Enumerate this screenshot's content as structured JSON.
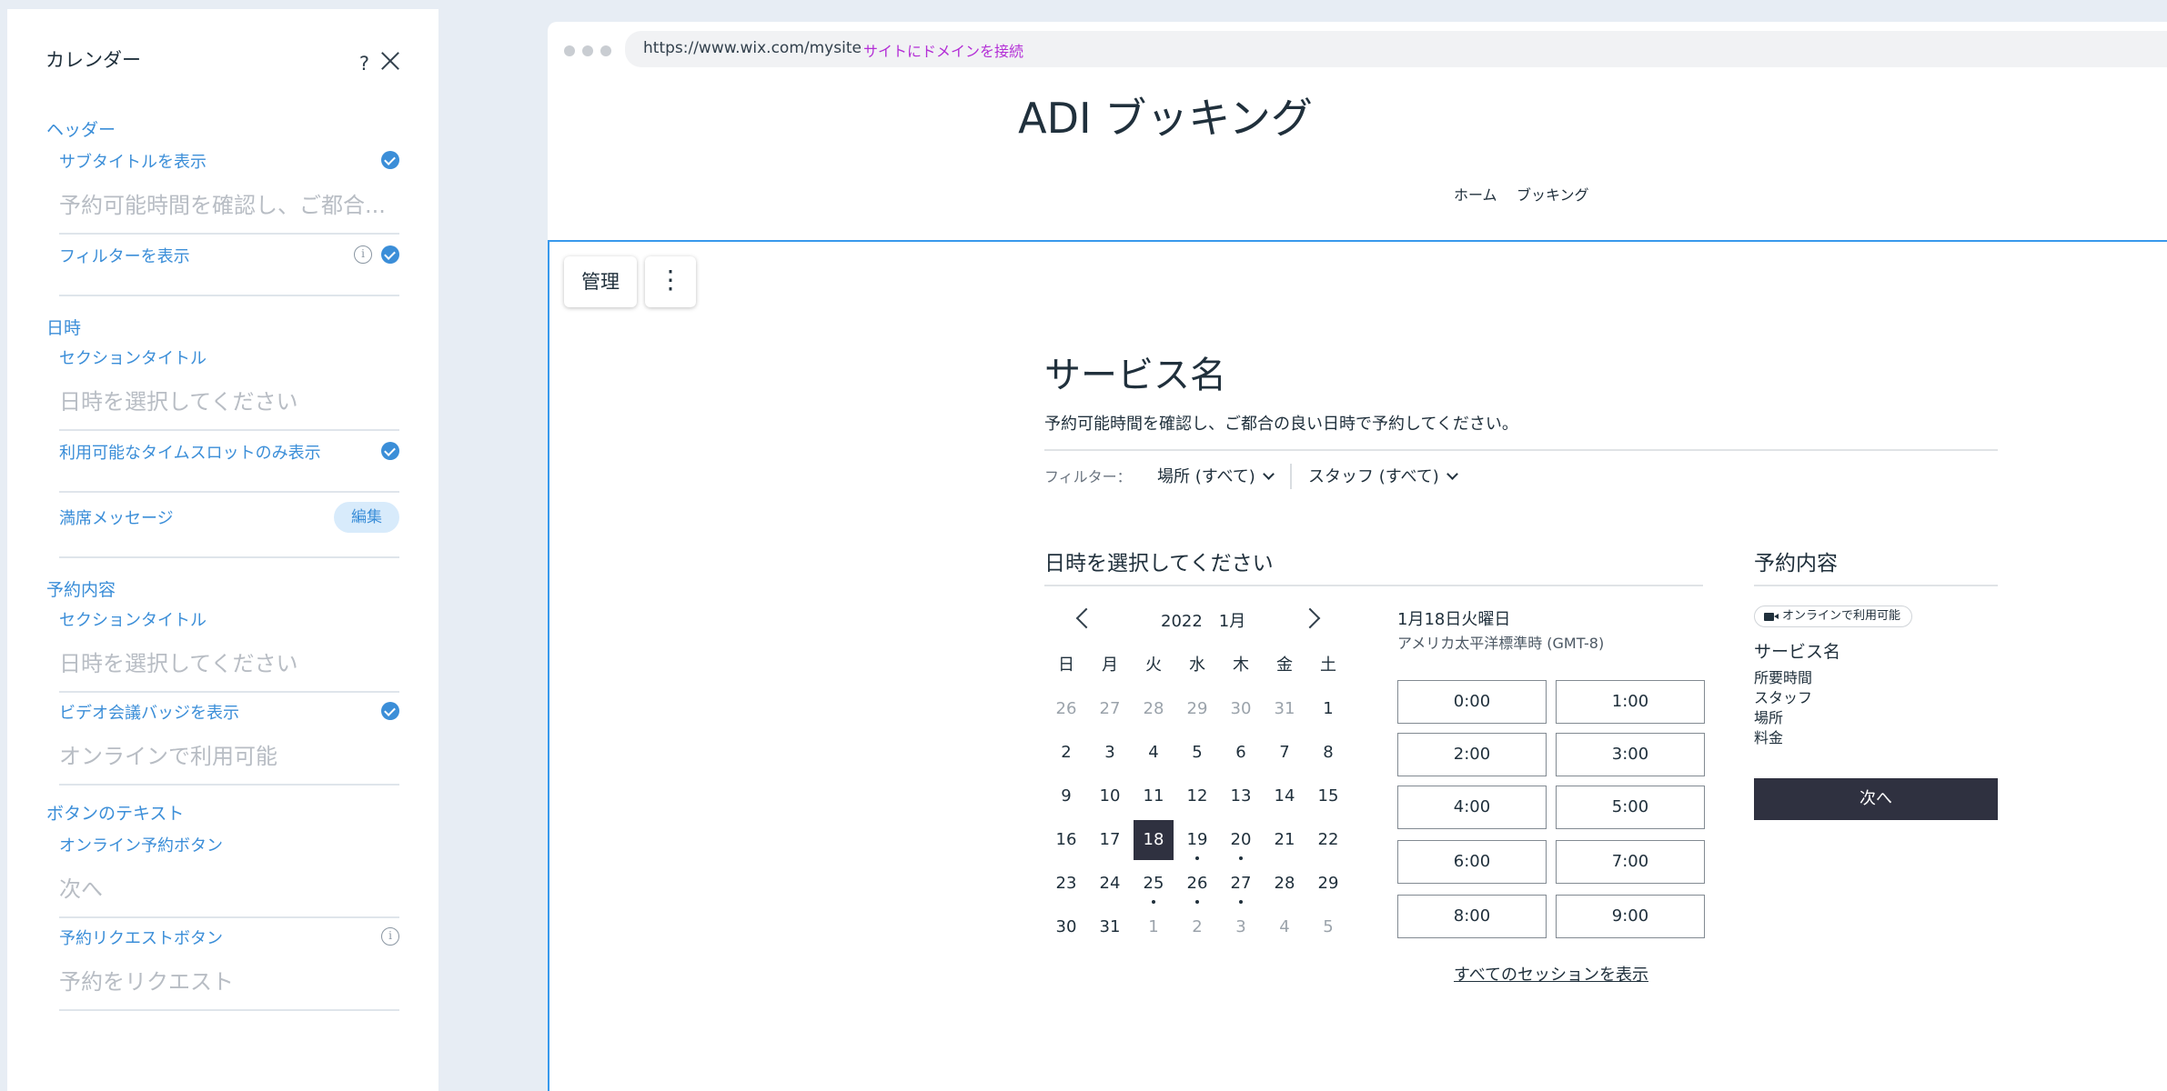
{
  "panel": {
    "title": "カレンダー",
    "help": "?",
    "sections": {
      "header": "ヘッダー",
      "datetime": "日時",
      "booking_details": "予約内容",
      "button_text": "ボタンのテキスト"
    },
    "rows": {
      "show_subtitle": {
        "label": "サブタイトルを表示",
        "value": "予約可能時間を確認し、ご都合...",
        "checked": true
      },
      "show_filter": {
        "label": "フィルターを表示",
        "checked": true
      },
      "dt_section_title": {
        "label": "セクションタイトル",
        "value": "日時を選択してください"
      },
      "only_available": {
        "label": "利用可能なタイムスロットのみ表示",
        "checked": true
      },
      "full_message": {
        "label": "満席メッセージ",
        "button": "編集"
      },
      "bd_section_title": {
        "label": "セクションタイトル",
        "value": "日時を選択してください"
      },
      "video_badge": {
        "label": "ビデオ会議バッジを表示",
        "value": "オンラインで利用可能",
        "checked": true
      },
      "online_button": {
        "label": "オンライン予約ボタン",
        "value": "次へ"
      },
      "request_button": {
        "label": "予約リクエストボタン",
        "value": "予約をリクエスト"
      }
    }
  },
  "browser": {
    "url": "https://www.wix.com/mysite",
    "connect_domain": "サイトにドメインを接続"
  },
  "site": {
    "title": "ADI ブッキング",
    "nav": [
      "ホーム",
      "ブッキング"
    ]
  },
  "editor": {
    "manage": "管理",
    "more": "⋮"
  },
  "widget": {
    "service_title": "サービス名",
    "description": "予約可能時間を確認し、ご都合の良い日時で予約してください。",
    "filter_label": "フィルター：",
    "filter_location": "場所 (すべて)",
    "filter_staff": "スタッフ (すべて)",
    "datetime_heading": "日時を選択してください",
    "calendar": {
      "month_label": "2022　1月",
      "weekdays": [
        "日",
        "月",
        "火",
        "水",
        "木",
        "金",
        "土"
      ],
      "weeks": [
        [
          "26",
          "27",
          "28",
          "29",
          "30",
          "31",
          "1"
        ],
        [
          "2",
          "3",
          "4",
          "5",
          "6",
          "7",
          "8"
        ],
        [
          "9",
          "10",
          "11",
          "12",
          "13",
          "14",
          "15"
        ],
        [
          "16",
          "17",
          "18",
          "19",
          "20",
          "21",
          "22"
        ],
        [
          "23",
          "24",
          "25",
          "26",
          "27",
          "28",
          "29"
        ],
        [
          "30",
          "31",
          "1",
          "2",
          "3",
          "4",
          "5"
        ]
      ],
      "selected_day": "18",
      "days_with_availability": [
        "19",
        "20",
        "25",
        "26",
        "27"
      ]
    },
    "selected_date": "1月18日火曜日",
    "timezone": "アメリカ太平洋標準時 (GMT-8)",
    "slots": [
      "0:00",
      "1:00",
      "2:00",
      "3:00",
      "4:00",
      "5:00",
      "6:00",
      "7:00",
      "8:00",
      "9:00"
    ],
    "show_all_sessions": "すべてのセッションを表示",
    "summary": {
      "heading": "予約内容",
      "badge": "オンラインで利用可能",
      "service": "サービス名",
      "items": [
        "所要時間",
        "スタッフ",
        "場所",
        "料金"
      ],
      "next_button": "次へ"
    }
  },
  "colors": {
    "accent": "#3B8ED8",
    "editor_frame": "#3899EC",
    "primary_button": "#2F3140",
    "domain_link": "#B32ED6"
  }
}
